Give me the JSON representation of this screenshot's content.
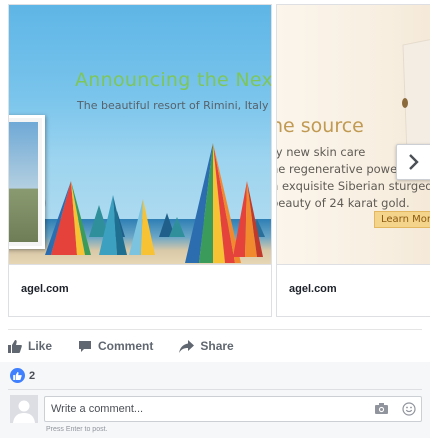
{
  "carousel": {
    "cards": [
      {
        "domain": "agel.com",
        "headline": "Announcing the Next",
        "subtitle": "The beautiful resort of Rimini, Italy"
      },
      {
        "domain": "agel.com",
        "title": "he source",
        "lines": [
          "ry new skin care",
          "ne regenerative powe",
          "n exquisite Siberian sturged",
          "beauty of 24 karat gold."
        ],
        "cta": "Learn More"
      }
    ]
  },
  "actions": {
    "like": "Like",
    "comment": "Comment",
    "share": "Share"
  },
  "reactions": {
    "count": "2"
  },
  "comment": {
    "placeholder": "Write a comment...",
    "hint": "Press Enter to post."
  },
  "colors": {
    "accent": "#4080ff",
    "headline": "#7ec65a",
    "gold": "#c09a52"
  }
}
